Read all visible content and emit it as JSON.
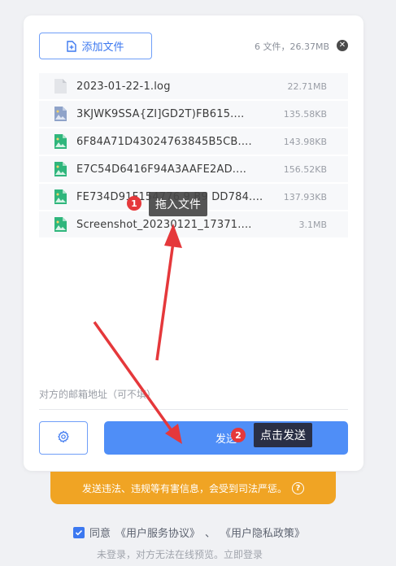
{
  "header": {
    "add_label": "添加文件",
    "summary": "6 文件，26.37MB"
  },
  "files": [
    {
      "name": "2023-01-22-1.log",
      "size": "22.71MB",
      "type": "doc"
    },
    {
      "name": "3KJWK9SSA{ZI]GD2T)FB615....",
      "size": "135.58KB",
      "type": "image-gray"
    },
    {
      "name": "6F84A71D43024763845B5CB....",
      "size": "143.98KB",
      "type": "image"
    },
    {
      "name": "E7C54D6416F94A3AAFE2AD....",
      "size": "156.52KB",
      "type": "image"
    },
    {
      "name": "FE734D91F154776 9 B9 DD784....",
      "size": "137.93KB",
      "type": "image"
    },
    {
      "name": "Screenshot_20230121_17371....",
      "size": "3.1MB",
      "type": "image"
    }
  ],
  "email": {
    "label": "对方的邮箱地址（可不填）"
  },
  "send": {
    "label": "发送"
  },
  "warning": {
    "text": "发送违法、违规等有害信息，会受到司法严惩。",
    "help": "?"
  },
  "agreement": {
    "prefix": "同意",
    "service": "《用户服务协议》",
    "separator": "、",
    "privacy": "《用户隐私政策》"
  },
  "login_tip": "未登录，对方无法在线预览。立即登录",
  "annotations": {
    "step1_badge": "1",
    "step1_text": "拖入文件",
    "step2_badge": "2",
    "step2_text": "点击发送"
  },
  "colors": {
    "accent": "#4f8ef7",
    "warning": "#f0a424",
    "arrow": "#e5383b"
  }
}
